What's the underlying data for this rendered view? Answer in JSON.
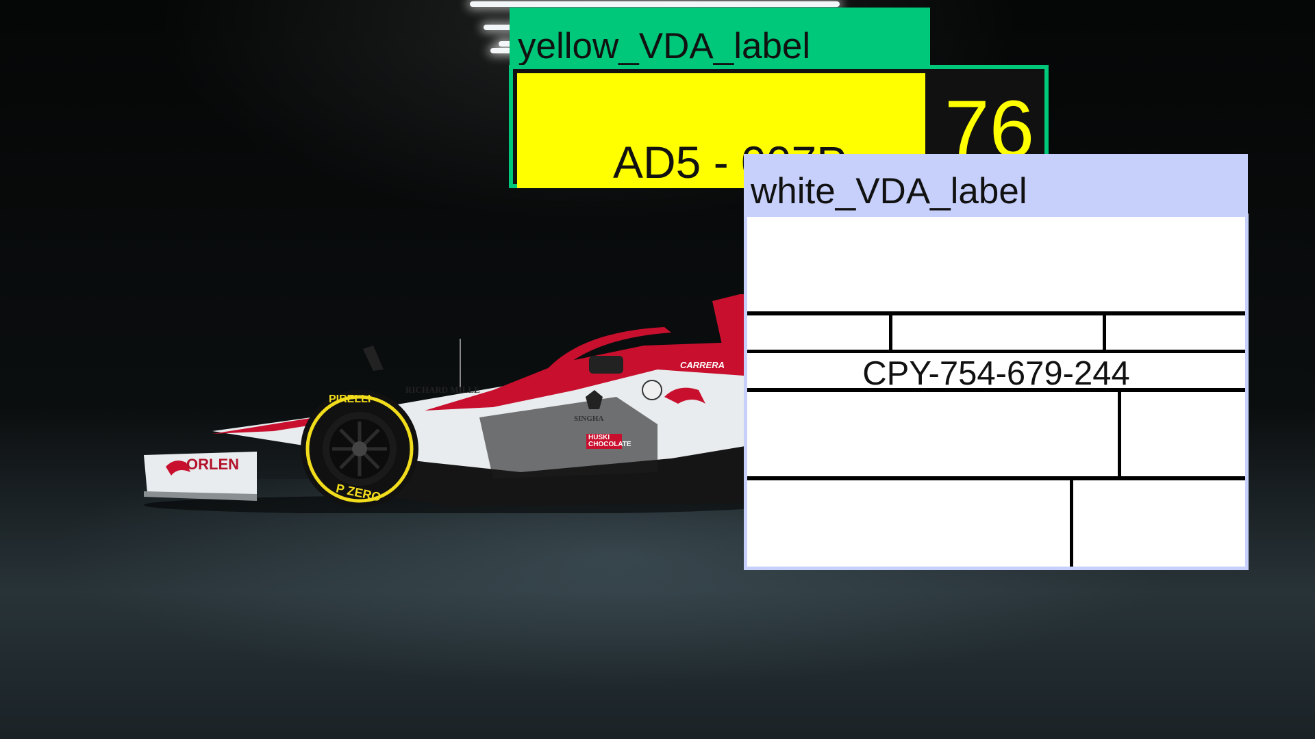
{
  "yellow_label": {
    "header": "yellow_VDA_label",
    "code": "AD5 - 007P",
    "number": "76"
  },
  "white_label": {
    "header": "white_VDA_label",
    "code": "CPY-754-679-244"
  },
  "car": {
    "sponsor_front_wing": "ORLEN",
    "sponsor_tyre": "PIRELLI",
    "sponsor_tyre_side": "P ZERO",
    "sponsor_side": "RICHARD MILLE",
    "sponsor_halo": "CARRERA",
    "sponsor_pod": "SINGHA",
    "sponsor_pod2": "HUSKI CHOCOLATE"
  },
  "colors": {
    "yellow_label_header": "#00c87a",
    "yellow_label_fill": "#ffff00",
    "white_label_header": "#c6d0fb",
    "car_red": "#c8102e",
    "car_white": "#e8ecee"
  }
}
